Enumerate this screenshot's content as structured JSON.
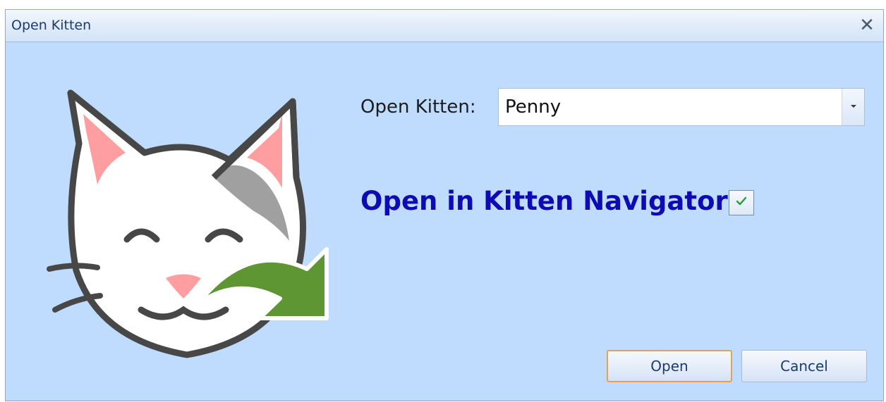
{
  "window": {
    "title": "Open Kitten",
    "close_glyph": "✕"
  },
  "form": {
    "open_label": "Open Kitten:",
    "kitten_select": {
      "value": "Penny"
    },
    "navigator_label": "Open in Kitten Navigator",
    "navigator_checked": true
  },
  "buttons": {
    "open_label": "Open",
    "cancel_label": "Cancel"
  },
  "illustration": {
    "icon": "cat-face-with-open-arrow-icon"
  },
  "colors": {
    "dialog_bg": "#bfdbfd",
    "navigator_text": "#0e0ab4",
    "default_button_border": "#e6a24c",
    "arrow_green": "#5f9634",
    "check_green": "#2a9a3a"
  }
}
